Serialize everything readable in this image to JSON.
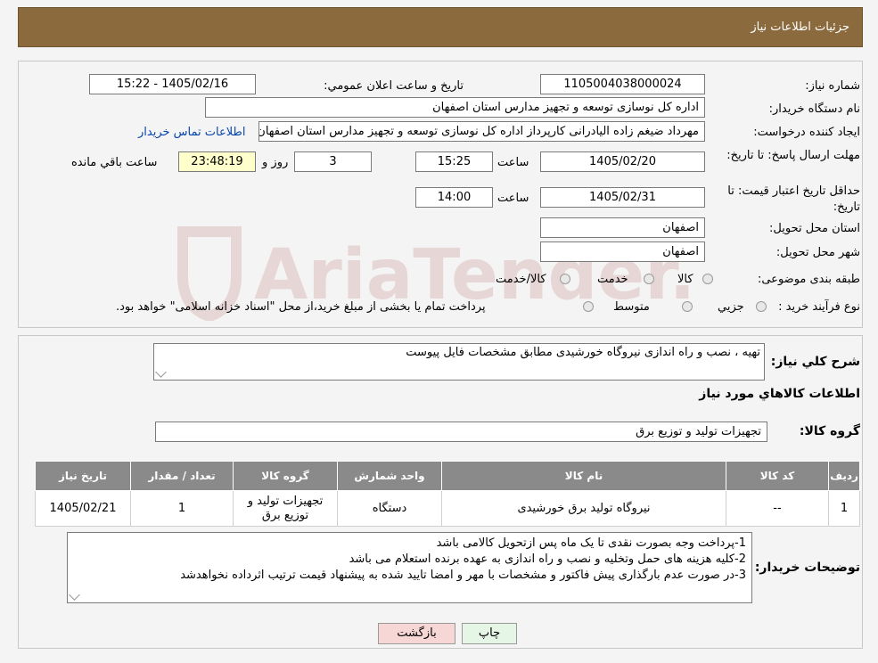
{
  "header": {
    "title": "جزئیات اطلاعات نیاز"
  },
  "form": {
    "need_number_label": "شماره نیاز:",
    "need_number": "1105004038000024",
    "announce_label": "تاریخ و ساعت اعلان عمومي:",
    "announce_value": "1405/02/16 - 15:22",
    "buyer_org_label": "نام دستگاه خريدار:",
    "buyer_org": "اداره کل نوسازی  توسعه و تجهیز مدارس استان اصفهان",
    "creator_label": "ايجاد کننده درخواست:",
    "creator": "مهرداد ضیغم زاده الیادرانی کارپرداز اداره کل نوسازی  توسعه و تجهیز مدارس استان اصفهان",
    "contact_link": "اطلاعات تماس خريدار",
    "deadline_label": "مهلت ارسال پاسخ: تا تاریخ:",
    "deadline_date": "1405/02/20",
    "time_label": "ساعت",
    "deadline_time": "15:25",
    "days_value": "3",
    "days_label": "روز و",
    "remaining_value": "23:48:19",
    "remaining_label": "ساعت باقي مانده",
    "validity_label": "حداقل تاريخ اعتبار قيمت: تا تاريخ:",
    "validity_date": "1405/02/31",
    "validity_time": "14:00",
    "province_label": "استان محل تحويل:",
    "province": "اصفهان",
    "city_label": "شهر محل تحويل:",
    "city": "اصفهان",
    "category_label": "طبقه بندی موضوعی:",
    "category_options": [
      "کالا",
      "خدمت",
      "کالا/خدمت"
    ],
    "process_label": "نوع فرآيند خريد :",
    "process_options": [
      "جزيي",
      "متوسط"
    ],
    "process_note": "پرداخت تمام یا بخشی از مبلغ خرید،از محل \"اسناد خزانه اسلامی\" خواهد بود."
  },
  "summary": {
    "desc_label": "شرح کلي نياز:",
    "desc_value": "تهیه ، نصب و راه اندازی نیروگاه خورشیدی مطابق مشخصات فایل پیوست",
    "goods_title": "اطلاعات کالاهاي مورد نياز",
    "group_label": "گروه کالا:",
    "group_value": "تجهیزات تولید و توزیع برق"
  },
  "table": {
    "headers": [
      "رديف",
      "کد کالا",
      "نام کالا",
      "واحد شمارش",
      "گروه کالا",
      "تعداد / مقدار",
      "تاريخ نياز"
    ],
    "rows": [
      [
        "1",
        "--",
        "نیروگاه تولید برق خورشیدی",
        "دستگاه",
        "تجهیزات تولید و توزیع برق",
        "1",
        "1405/02/21"
      ]
    ]
  },
  "notes": {
    "label": "توضيحات خريدار:",
    "lines": [
      "1-پرداخت وجه بصورت نقدی تا یک ماه پس ازتحویل کالامی باشد",
      "2-کلیه هزینه های حمل وتخلیه و نصب و راه اندازی به عهده برنده استعلام می باشد",
      "3-در صورت عدم بارگذاری پیش فاکتور و مشخصات با مهر و امضا تایید شده به پیشنهاد قیمت ترتیب اثرداده نخواهدشد"
    ]
  },
  "buttons": {
    "print": "چاپ",
    "back": "بازگشت"
  },
  "watermark": {
    "text": "AriaTender.neT"
  },
  "colors": {
    "header": "#8b6a3d",
    "table_header": "#8a8a8a",
    "remaining_bg": "#ffffcc",
    "back_btn": "#f7d6d6",
    "print_btn": "#e6f6e6"
  }
}
